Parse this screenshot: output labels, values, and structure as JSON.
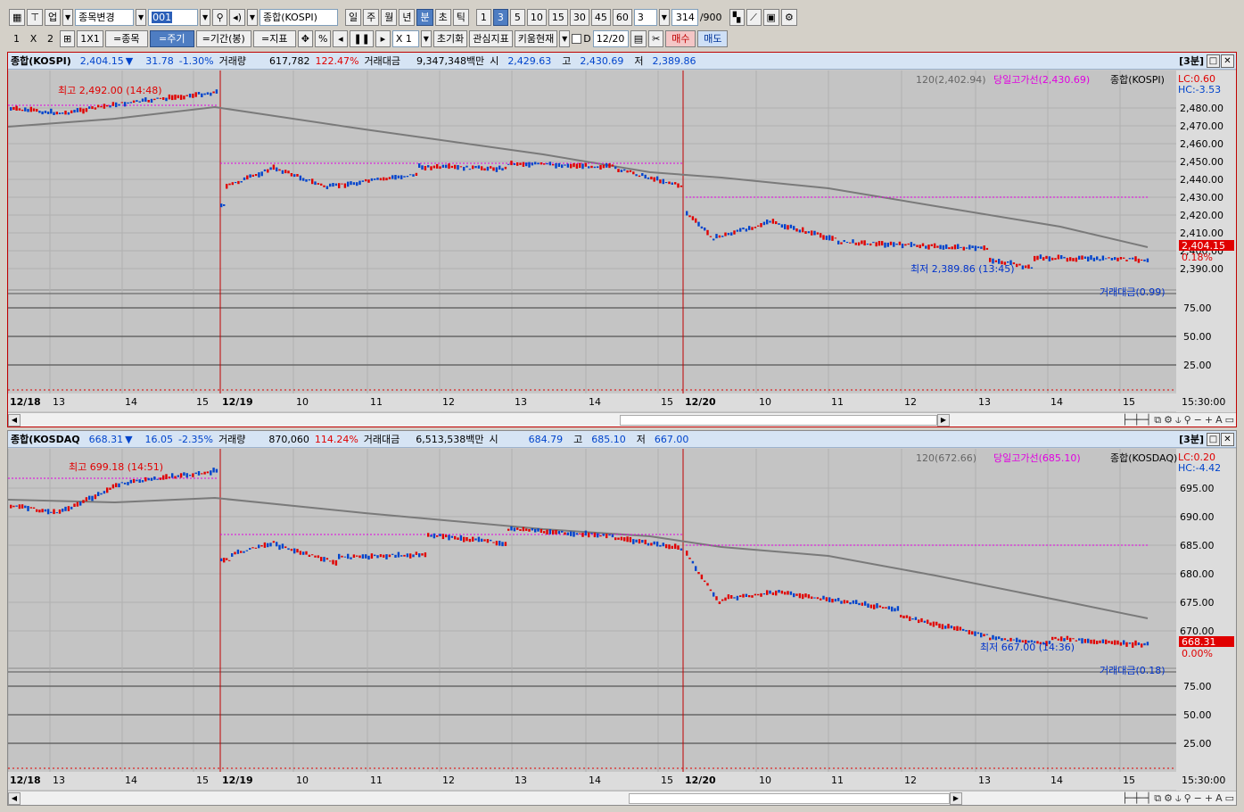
{
  "toolbar1": {
    "market": "업",
    "change_stock": "종목변경",
    "code": "001",
    "index_name": "종합(KOSPI)",
    "periods": [
      "일",
      "주",
      "월",
      "년",
      "분",
      "초",
      "틱"
    ],
    "selected_period": "분",
    "minutes": [
      "1",
      "3",
      "5",
      "10",
      "15",
      "30",
      "45",
      "60"
    ],
    "selected_minute": "3",
    "interval_value": "3",
    "count": "314",
    "count_max": "/900"
  },
  "toolbar2": {
    "layout": [
      "1",
      "X",
      "2"
    ],
    "layout_1x1": "1X1",
    "stock_btn": "=종목",
    "period_btn": "=주기",
    "range_btn": "=기간(봉)",
    "indicator_btn": "=지표",
    "percent": "%",
    "zoom": "X 1",
    "reset": "초기화",
    "watch_ind": "관심지표",
    "kiwoom_now": "키움현재",
    "d_label": "D",
    "date": "12/20",
    "buy": "매수",
    "sell": "매도"
  },
  "panel1": {
    "title": "종합(KOSPI)",
    "price": "2,404.15",
    "arrow": "▼",
    "change": "31.78",
    "change_pct": "-1.30%",
    "vol_label": "거래량",
    "volume": "617,782",
    "vol_pct": "122.47%",
    "amt_label": "거래대금",
    "amount": "9,347,348백만",
    "open_label": "시",
    "open": "2,429.63",
    "high_label": "고",
    "high": "2,430.69",
    "low_label": "저",
    "low": "2,389.86",
    "interval_tag": "[3분]",
    "legend_ma": "120(2,402.94)",
    "legend_high": "당일고가선(2,430.69)",
    "legend_name": "종합(KOSPI)",
    "lc": "LC:0.60",
    "hc": "HC:-3.53",
    "high_note": "최고 2,492.00 (14:48)",
    "low_note": "최저 2,389.86 (13:45)",
    "last_price": "2,404.15",
    "last_pct": "0.18%",
    "sub_legend": "거래대금(0.99)",
    "y_ticks": [
      "2,480.00",
      "2,470.00",
      "2,460.00",
      "2,450.00",
      "2,440.00",
      "2,430.00",
      "2,420.00",
      "2,410.00",
      "2,400.00",
      "2,390.00"
    ],
    "sub_ticks": [
      "75.00",
      "50.00",
      "25.00"
    ],
    "x_labels": [
      "12/18",
      "13",
      "14",
      "15",
      "12/19",
      "10",
      "11",
      "12",
      "13",
      "14",
      "15",
      "12/20",
      "10",
      "11",
      "12",
      "13",
      "14",
      "15"
    ],
    "time_label": "15:30:00"
  },
  "panel2": {
    "title": "종합(KOSDAQ",
    "price": "668.31",
    "arrow": "▼",
    "change": "16.05",
    "change_pct": "-2.35%",
    "vol_label": "거래량",
    "volume": "870,060",
    "vol_pct": "114.24%",
    "amt_label": "거래대금",
    "amount": "6,513,538백만",
    "open_label": "시",
    "open": "684.79",
    "high_label": "고",
    "high": "685.10",
    "low_label": "저",
    "low": "667.00",
    "interval_tag": "[3분]",
    "legend_ma": "120(672.66)",
    "legend_high": "당일고가선(685.10)",
    "legend_name": "종합(KOSDAQ)",
    "lc": "LC:0.20",
    "hc": "HC:-4.42",
    "high_note": "최고 699.18 (14:51)",
    "low_note": "최저 667.00 (14:36)",
    "last_price": "668.31",
    "last_pct": "0.00%",
    "sub_legend": "거래대금(0.18)",
    "y_ticks": [
      "695.00",
      "690.00",
      "685.00",
      "680.00",
      "675.00",
      "670.00"
    ],
    "sub_ticks": [
      "75.00",
      "50.00",
      "25.00"
    ],
    "x_labels": [
      "12/18",
      "13",
      "14",
      "15",
      "12/19",
      "10",
      "11",
      "12",
      "13",
      "14",
      "15",
      "12/20",
      "10",
      "11",
      "12",
      "13",
      "14",
      "15"
    ],
    "time_label": "15:30:00"
  },
  "colors": {
    "up": "#e00000",
    "down": "#0044cc",
    "ma": "#7a7a7a",
    "high_line": "#e000e0",
    "divider": "#c00000"
  }
}
